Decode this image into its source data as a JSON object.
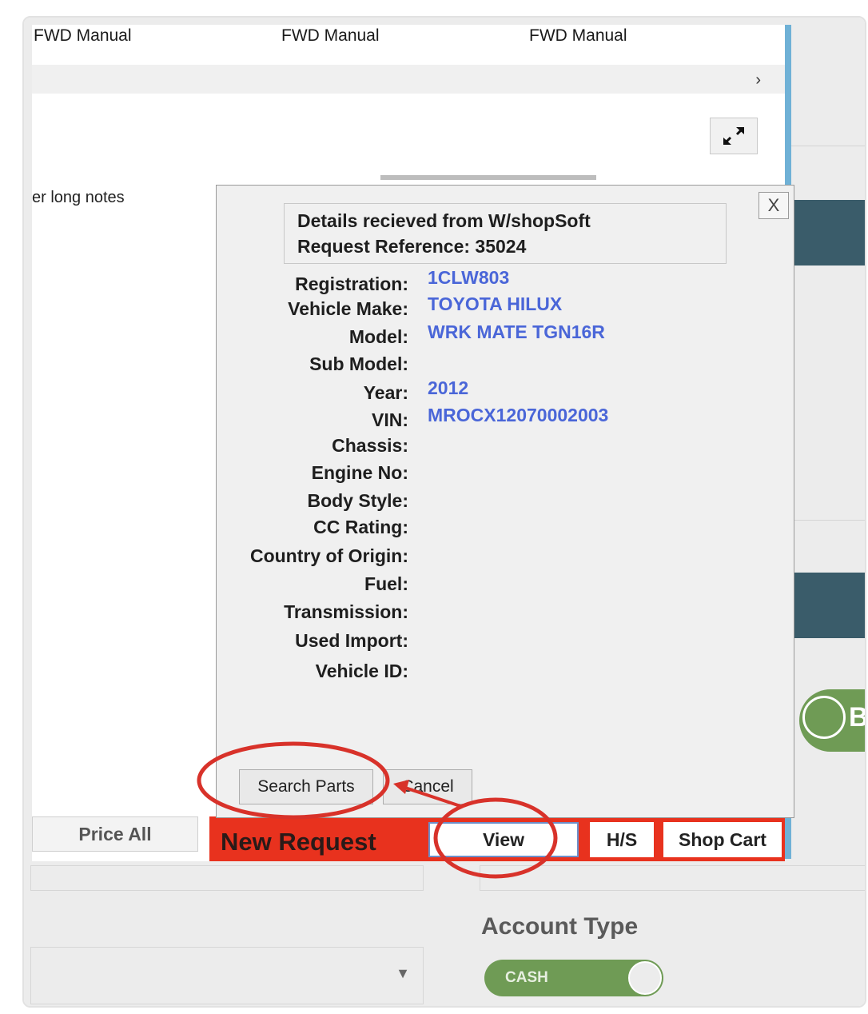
{
  "grid": {
    "col_headers": [
      "FWD Manual",
      "FWD Manual",
      "FWD Manual"
    ],
    "scroll_right_glyph": "›"
  },
  "notes_label": "er long notes",
  "dialog": {
    "close_label": "X",
    "header_line1": "Details recieved from W/shopSoft",
    "header_line2": "Request Reference: 35024",
    "fields": [
      {
        "label": "Registration:",
        "value": "1CLW803"
      },
      {
        "label": "Vehicle Make:",
        "value": "TOYOTA HILUX"
      },
      {
        "label": "Model:",
        "value": "WRK MATE TGN16R"
      },
      {
        "label": "Sub Model:",
        "value": ""
      },
      {
        "label": "Year:",
        "value": "2012"
      },
      {
        "label": "VIN:",
        "value": "MROCX12070002003"
      },
      {
        "label": "Chassis:",
        "value": ""
      },
      {
        "label": "Engine No:",
        "value": ""
      },
      {
        "label": "Body Style:",
        "value": ""
      },
      {
        "label": "CC Rating:",
        "value": ""
      },
      {
        "label": "Country of Origin:",
        "value": ""
      },
      {
        "label": "Fuel:",
        "value": ""
      },
      {
        "label": "Transmission:",
        "value": ""
      },
      {
        "label": "Used Import:",
        "value": ""
      },
      {
        "label": "Vehicle ID:",
        "value": ""
      }
    ],
    "search_parts_label": "Search Parts",
    "cancel_label": "Cancel"
  },
  "toolbar": {
    "price_all_label": "Price All",
    "new_request_label": "New Request",
    "view_label": "View",
    "hs_label": "H/S",
    "shop_cart_label": "Shop Cart",
    "accent_color": "#e8321e"
  },
  "background": {
    "account_type_label": "Account Type",
    "cash_toggle_label": "CASH",
    "partial_button_letter": "B",
    "select_arrow_glyph": "▼"
  },
  "annotations": {
    "highlight_color": "#d8322a"
  }
}
